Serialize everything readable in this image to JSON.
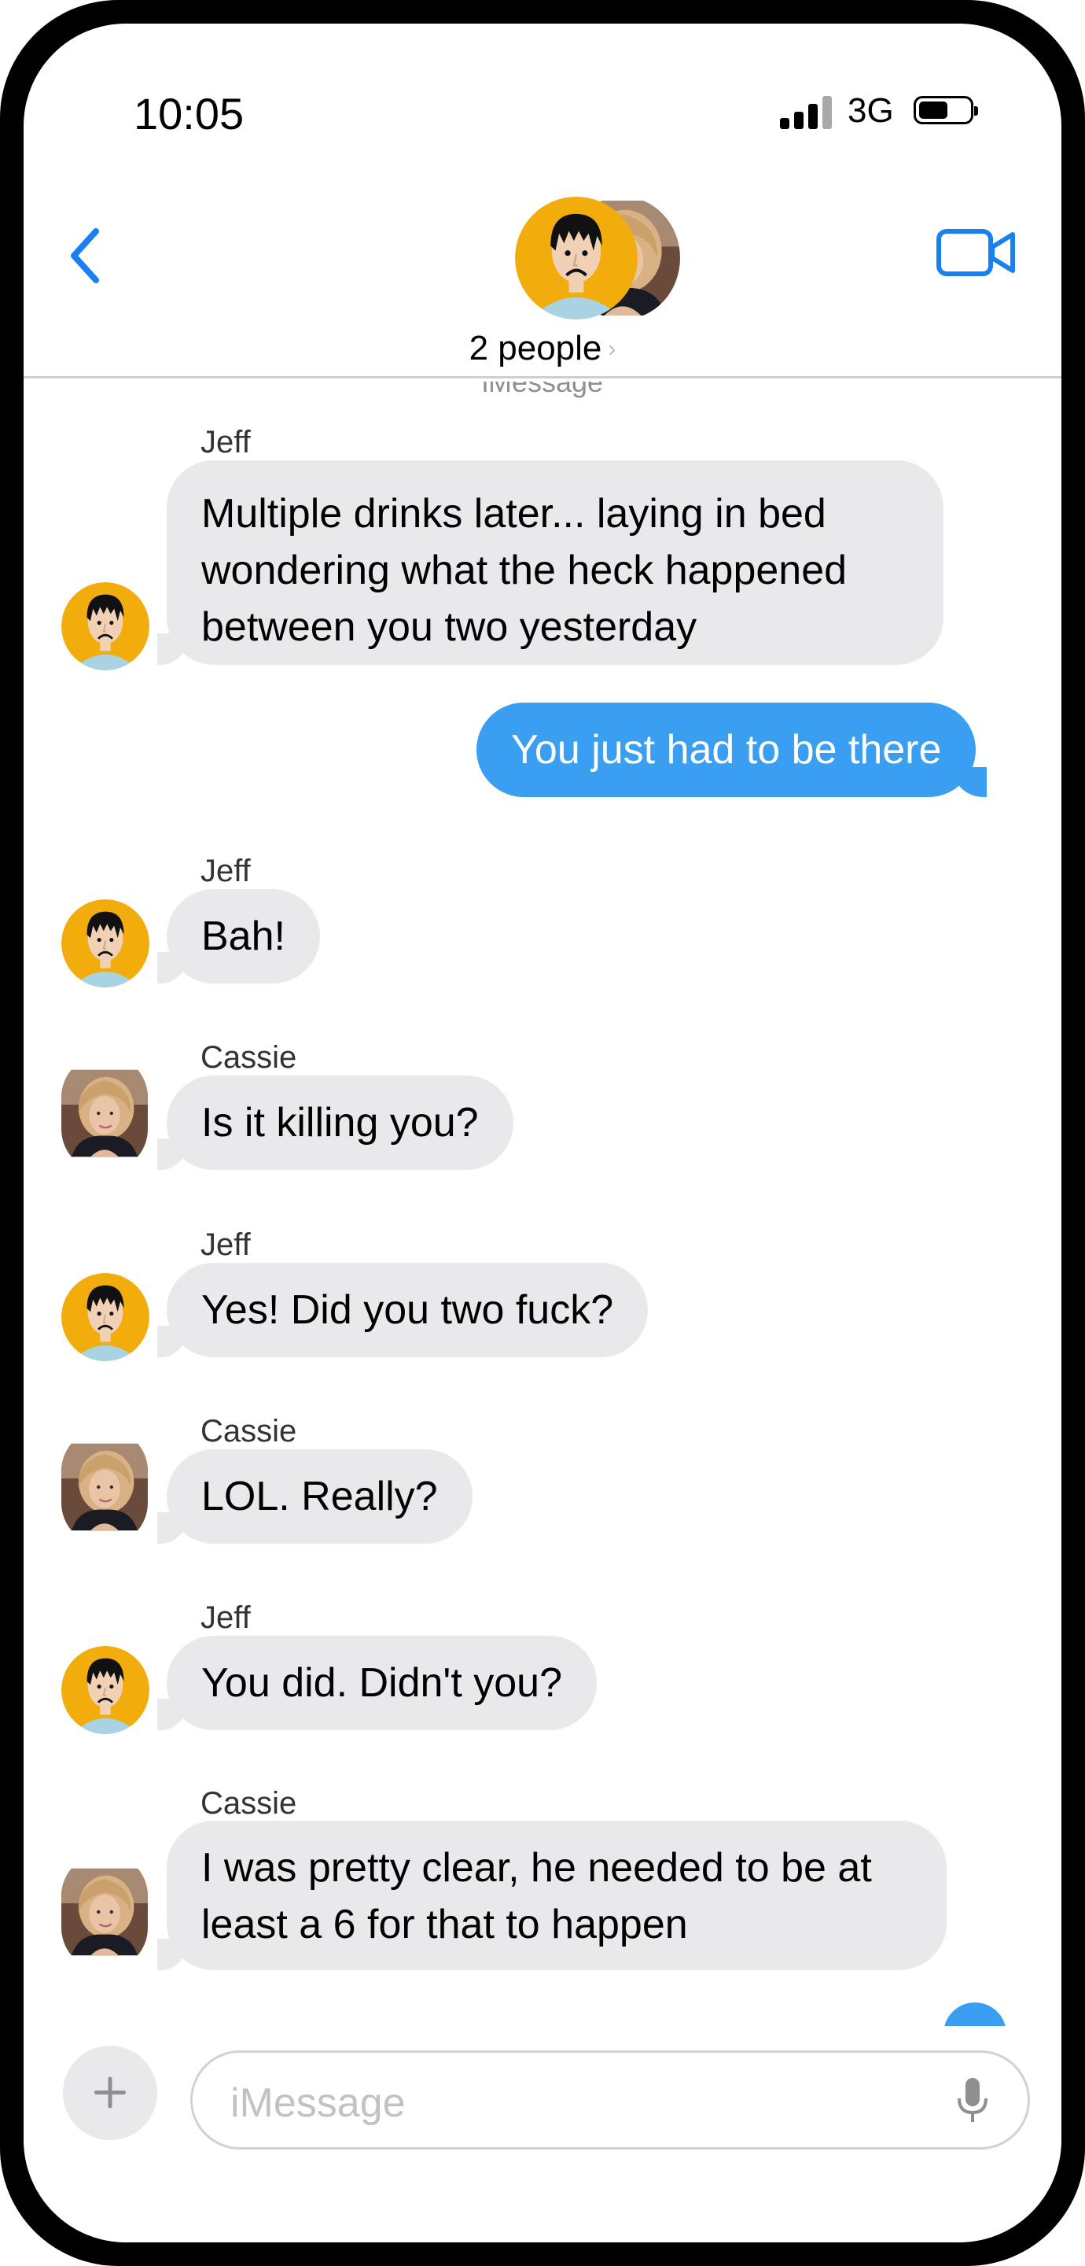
{
  "status_bar": {
    "time": "10:05",
    "network": "3G"
  },
  "header": {
    "title": "2 people",
    "chevron": "›"
  },
  "thread_label": "iMessage",
  "messages": [
    {
      "sender": "Jeff",
      "text_lines": [
        "Multiple drinks later... laying in bed",
        "wondering what the heck happened",
        "between you two yesterday"
      ]
    },
    {
      "sender": "me",
      "text": "You just had to be there"
    },
    {
      "sender": "Jeff",
      "text": "Bah!"
    },
    {
      "sender": "Cassie",
      "text": "Is it killing you?"
    },
    {
      "sender": "Jeff",
      "text": "Yes!  Did you two fuck?"
    },
    {
      "sender": "Cassie",
      "text": "LOL.  Really?"
    },
    {
      "sender": "Jeff",
      "text": "You did.  Didn't you?"
    },
    {
      "sender": "Cassie",
      "text_lines": [
        "I was pretty clear, he needed to be at",
        "least a 6 for that to happen"
      ]
    }
  ],
  "composer": {
    "placeholder": "iMessage"
  },
  "colors": {
    "accent": "#1a7ff0",
    "sent_bubble": "#3a9ff0",
    "received_bubble": "#e9e9eb",
    "avatar_bg": "#f2ac0c"
  },
  "icons": [
    "back-chevron-icon",
    "video-camera-icon",
    "plus-icon",
    "microphone-icon"
  ]
}
